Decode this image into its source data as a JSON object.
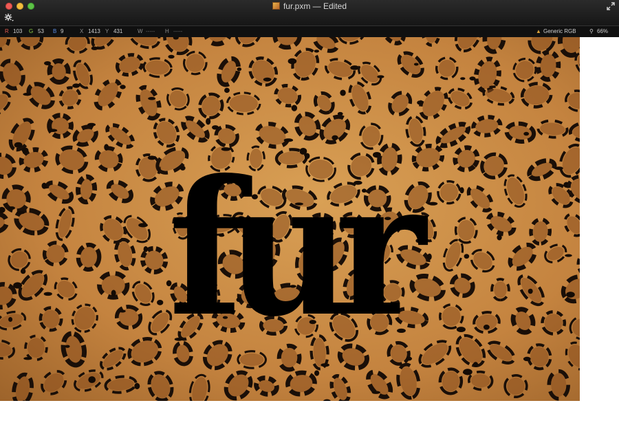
{
  "window": {
    "title": "fur.pxm",
    "edited": "— Edited",
    "accent": "#161616"
  },
  "toolbar": {
    "gear_icon": "gear-icon",
    "fullscreen_icon": "fullscreen-icon"
  },
  "infobar": {
    "r_label": "R",
    "r_value": "103",
    "g_label": "G",
    "g_value": "53",
    "b_label": "B",
    "b_value": "9",
    "x_label": "X",
    "x_value": "1413",
    "y_label": "Y",
    "y_value": "431",
    "w_label": "W",
    "w_value": "-----",
    "h_label": "H",
    "h_value": "-----",
    "color_profile": "Generic RGB",
    "zoom": "66%"
  },
  "canvas": {
    "text": "fur",
    "text_color": "#000000",
    "background": "leopard fur pattern"
  }
}
